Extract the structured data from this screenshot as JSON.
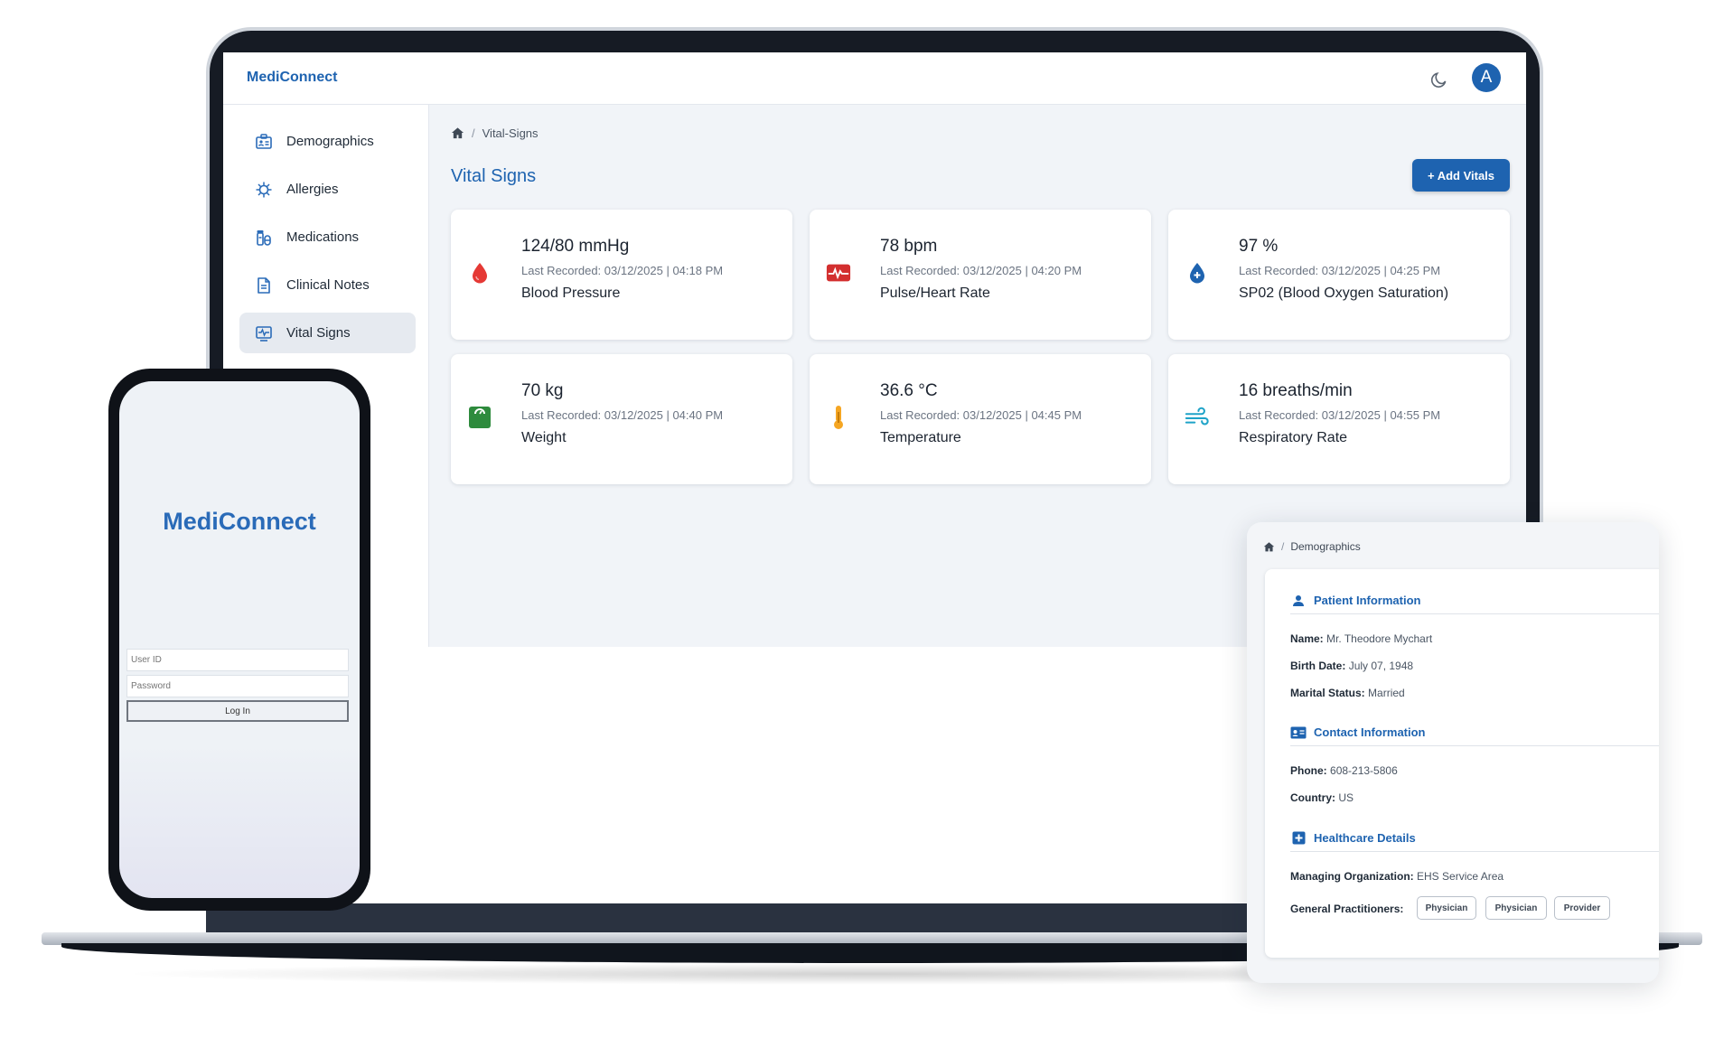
{
  "app": {
    "brand": "MediConnect",
    "avatar_initial": "A"
  },
  "sidebar": {
    "items": [
      {
        "label": "Demographics",
        "icon": "id-card-icon"
      },
      {
        "label": "Allergies",
        "icon": "virus-icon"
      },
      {
        "label": "Medications",
        "icon": "pills-icon"
      },
      {
        "label": "Clinical Notes",
        "icon": "document-icon"
      },
      {
        "label": "Vital Signs",
        "icon": "monitor-heartbeat-icon",
        "active": true
      }
    ]
  },
  "main": {
    "breadcrumb": {
      "sep": "/",
      "current": "Vital-Signs"
    },
    "title": "Vital Signs",
    "add_button": "+ Add Vitals",
    "cards": [
      {
        "value": "124/80 mmHg",
        "recorded": "Last Recorded: 03/12/2025 | 04:18 PM",
        "label": "Blood Pressure",
        "icon": "blood-drop-icon",
        "color": "#e53935"
      },
      {
        "value": "78 bpm",
        "recorded": "Last Recorded: 03/12/2025 | 04:20 PM",
        "label": "Pulse/Heart Rate",
        "icon": "heart-monitor-icon",
        "color": "#d32f2f"
      },
      {
        "value": "97 %",
        "recorded": "Last Recorded: 03/12/2025 | 04:25 PM",
        "label": "SP02 (Blood Oxygen Saturation)",
        "icon": "oxygen-drop-icon",
        "color": "#1e63b0"
      },
      {
        "value": "70 kg",
        "recorded": "Last Recorded: 03/12/2025 | 04:40 PM",
        "label": "Weight",
        "icon": "scale-icon",
        "color": "#2e8b3d"
      },
      {
        "value": "36.6 °C",
        "recorded": "Last Recorded: 03/12/2025 | 04:45 PM",
        "label": "Temperature",
        "icon": "thermometer-icon",
        "color": "#f5a623"
      },
      {
        "value": "16 breaths/min",
        "recorded": "Last Recorded: 03/12/2025 | 04:55 PM",
        "label": "Respiratory Rate",
        "icon": "wind-icon",
        "color": "#1fa3c8"
      }
    ]
  },
  "phone": {
    "brand": "MediConnect",
    "user_placeholder": "User ID",
    "password_placeholder": "Password",
    "login_label": "Log In"
  },
  "demographics": {
    "breadcrumb": {
      "sep": "/",
      "current": "Demographics"
    },
    "patient": {
      "heading": "Patient Information",
      "name_label": "Name:",
      "name": "Mr. Theodore Mychart",
      "birth_label": "Birth Date:",
      "birth": "July 07, 1948",
      "marital_label": "Marital Status:",
      "marital": "Married"
    },
    "contact": {
      "heading": "Contact Information",
      "phone_label": "Phone:",
      "phone": "608-213-5806",
      "country_label": "Country:",
      "country": "US"
    },
    "healthcare": {
      "heading": "Healthcare Details",
      "org_label": "Managing Organization:",
      "org": "EHS Service Area",
      "gp_label": "General Practitioners:",
      "chips": [
        "Physician",
        "Physician",
        "Provider"
      ]
    }
  }
}
